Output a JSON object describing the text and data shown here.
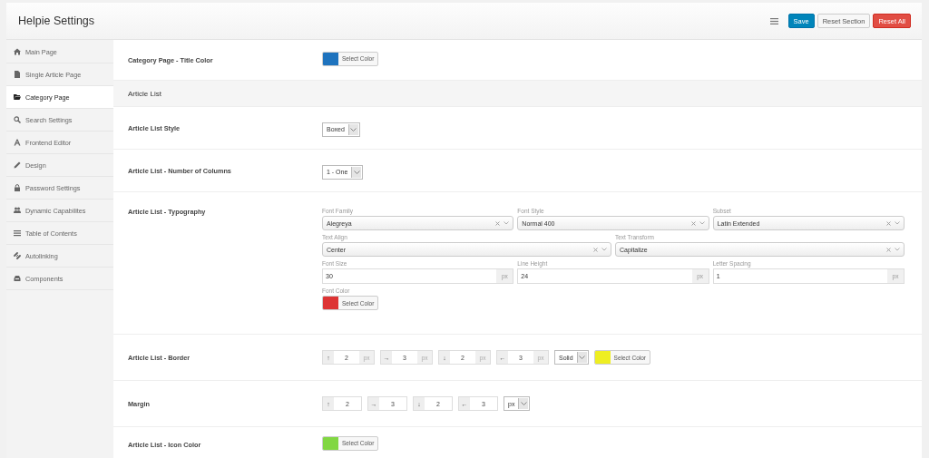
{
  "header": {
    "title": "Helpie Settings",
    "buttons": [
      {
        "label": "Save",
        "kind": "primary"
      },
      {
        "label": "Reset Section",
        "kind": "default"
      },
      {
        "label": "Reset All",
        "kind": "danger"
      }
    ]
  },
  "sidebar": {
    "items": [
      {
        "label": "Main Page",
        "selected": false
      },
      {
        "label": "Single Article Page",
        "selected": false
      },
      {
        "label": "Category Page",
        "selected": true
      },
      {
        "label": "Search Settings",
        "selected": false
      },
      {
        "label": "Frontend Editor",
        "selected": false
      },
      {
        "label": "Design",
        "selected": false
      },
      {
        "label": "Password Settings",
        "selected": false
      },
      {
        "label": "Dynamic Capabilites",
        "selected": false
      },
      {
        "label": "Table of Contents",
        "selected": false
      },
      {
        "label": "Autolinking",
        "selected": false
      },
      {
        "label": "Components",
        "selected": false
      }
    ]
  },
  "rows": [
    {
      "kind": "color",
      "label": "Category Page - Title Color",
      "color": "#1e73be",
      "button": "Select Color"
    },
    {
      "kind": "heading",
      "label": "Article List"
    },
    {
      "kind": "select",
      "label": "Article List Style",
      "value": "Boxed"
    },
    {
      "kind": "select",
      "label": "Article List - Number of Columns",
      "value": "1 - One"
    },
    {
      "kind": "typography",
      "label": "Article List - Typography",
      "lines": [
        [
          {
            "kind": "select",
            "label": "Font Family",
            "value": "Alegreya"
          },
          {
            "kind": "select",
            "label": "Font Style",
            "value": "Normal 400"
          },
          {
            "kind": "select",
            "label": "Subset",
            "value": "Latin Extended"
          }
        ],
        [
          {
            "kind": "select",
            "label": "Text Align",
            "value": "Center"
          },
          {
            "kind": "select",
            "label": "Text Transform",
            "value": "Capitalize"
          }
        ],
        [
          {
            "kind": "unit",
            "label": "Font Size",
            "value": "30",
            "unit": "px"
          },
          {
            "kind": "unit",
            "label": "Line Height",
            "value": "24",
            "unit": "px"
          },
          {
            "kind": "unit",
            "label": "Letter Spacing",
            "value": "1",
            "unit": "px"
          }
        ],
        [
          {
            "kind": "color",
            "label": "Font Color",
            "color": "#dd3333",
            "button": "Select Color"
          }
        ]
      ]
    },
    {
      "kind": "border",
      "label": "Article List - Border",
      "sides": [
        {
          "arrow": "↑",
          "value": "2",
          "unit": "px"
        },
        {
          "arrow": "→",
          "value": "3",
          "unit": "px"
        },
        {
          "arrow": "↓",
          "value": "2",
          "unit": "px"
        },
        {
          "arrow": "←",
          "value": "3",
          "unit": "px"
        }
      ],
      "style": "Solid",
      "color": "#eeee22",
      "button": "Select Color"
    },
    {
      "kind": "margin",
      "label": "Margin",
      "sides": [
        {
          "arrow": "↑",
          "value": "2"
        },
        {
          "arrow": "→",
          "value": "3"
        },
        {
          "arrow": "↓",
          "value": "2"
        },
        {
          "arrow": "←",
          "value": "3"
        }
      ],
      "unit": "px"
    },
    {
      "kind": "color",
      "label": "Article List - Icon Color",
      "color": "#81d742",
      "button": "Select Color"
    }
  ]
}
